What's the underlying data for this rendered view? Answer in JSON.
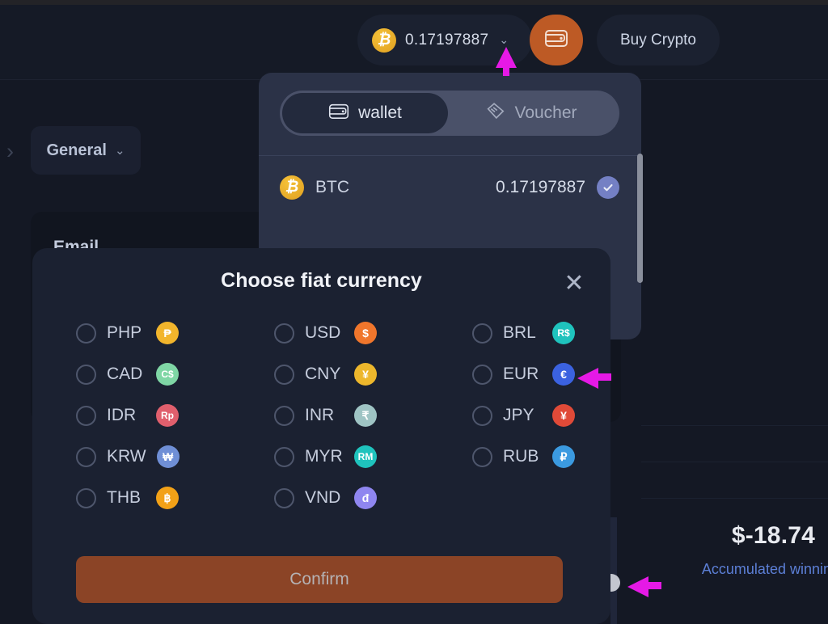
{
  "header": {
    "balance": {
      "coin_symbol": "₿",
      "coin_name": "btc-coin-icon",
      "amount": "0.17197887",
      "caret": "⌄"
    },
    "wallet_button_icon": "wallet-icon",
    "buy_crypto_label": "Buy Crypto"
  },
  "wallet_dropdown": {
    "tabs": [
      {
        "label": "wallet",
        "icon": "wallet-icon",
        "active": true
      },
      {
        "label": "Voucher",
        "icon": "ticket-icon",
        "active": false
      }
    ],
    "coins": [
      {
        "code": "BTC",
        "symbol": "₿",
        "amount": "0.17197887",
        "selected": true
      }
    ]
  },
  "background": {
    "breadcrumb_chevron": "›",
    "general_dropdown": {
      "label": "General",
      "caret": "⌄"
    },
    "email_label": "Email",
    "accumulated": {
      "amount": "$-18.74",
      "label": "Accumulated winnin"
    }
  },
  "modal": {
    "title": "Choose fiat currency",
    "close_icon": "✕",
    "confirm_label": "Confirm",
    "currencies": [
      {
        "code": "PHP",
        "glyph": "₱",
        "color": "#f2b52c",
        "text_color": "#ffffff",
        "selected": false
      },
      {
        "code": "USD",
        "glyph": "$",
        "color": "#f0762c",
        "text_color": "#ffffff",
        "selected": false
      },
      {
        "code": "BRL",
        "glyph": "R$",
        "color": "#1fc3bd",
        "text_color": "#ffffff",
        "selected": false
      },
      {
        "code": "CAD",
        "glyph": "C$",
        "color": "#7fd6a5",
        "text_color": "#ffffff",
        "selected": false
      },
      {
        "code": "CNY",
        "glyph": "¥",
        "color": "#edb72c",
        "text_color": "#ffffff",
        "selected": false
      },
      {
        "code": "EUR",
        "glyph": "€",
        "color": "#3b62e0",
        "text_color": "#ffffff",
        "selected": false
      },
      {
        "code": "IDR",
        "glyph": "Rp",
        "color": "#e05f6d",
        "text_color": "#ffffff",
        "selected": false
      },
      {
        "code": "INR",
        "glyph": "₹",
        "color": "#9fc4c4",
        "text_color": "#ffffff",
        "selected": false
      },
      {
        "code": "JPY",
        "glyph": "¥",
        "color": "#e04a38",
        "text_color": "#ffffff",
        "selected": false
      },
      {
        "code": "KRW",
        "glyph": "₩",
        "color": "#6f8fd6",
        "text_color": "#ffffff",
        "selected": false
      },
      {
        "code": "MYR",
        "glyph": "RM",
        "color": "#1fc3bd",
        "text_color": "#ffffff",
        "selected": false
      },
      {
        "code": "RUB",
        "glyph": "₽",
        "color": "#3b9ae0",
        "text_color": "#ffffff",
        "selected": false
      },
      {
        "code": "THB",
        "glyph": "฿",
        "color": "#f2a117",
        "text_color": "#ffffff",
        "selected": false
      },
      {
        "code": "VND",
        "glyph": "đ",
        "color": "#8f86f0",
        "text_color": "#ffffff",
        "selected": false
      }
    ]
  },
  "theme": {
    "accent": "#bd5a25",
    "panel": "#1b2131",
    "dropdown": "#2b3247",
    "cursor_arrow": "#e619e6"
  }
}
